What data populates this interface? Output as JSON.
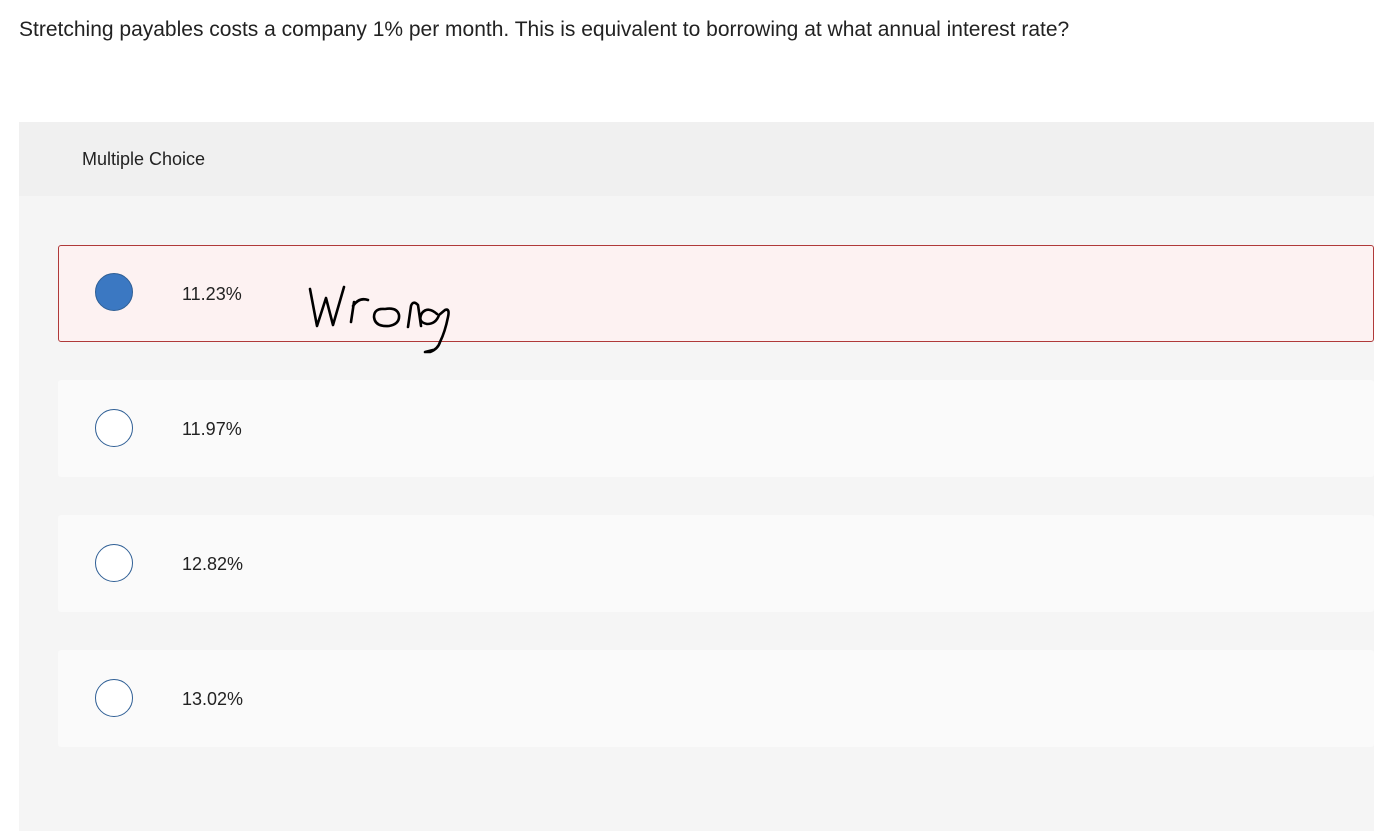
{
  "question": {
    "text": "Stretching payables costs a company 1% per month. This is equivalent to borrowing at what annual interest rate?"
  },
  "multiple_choice": {
    "title": "Multiple Choice",
    "selected_index": 0,
    "options": [
      {
        "label": "11.23%",
        "selected": true
      },
      {
        "label": "11.97%",
        "selected": false
      },
      {
        "label": "12.82%",
        "selected": false
      },
      {
        "label": "13.02%",
        "selected": false
      }
    ]
  },
  "annotation": {
    "handwritten_text": "Wrong"
  },
  "colors": {
    "selected_radio_fill": "#3b78c2",
    "radio_border": "#2f5f95",
    "selected_option_border": "#b03a3a",
    "selected_option_background": "#fdf2f2"
  }
}
